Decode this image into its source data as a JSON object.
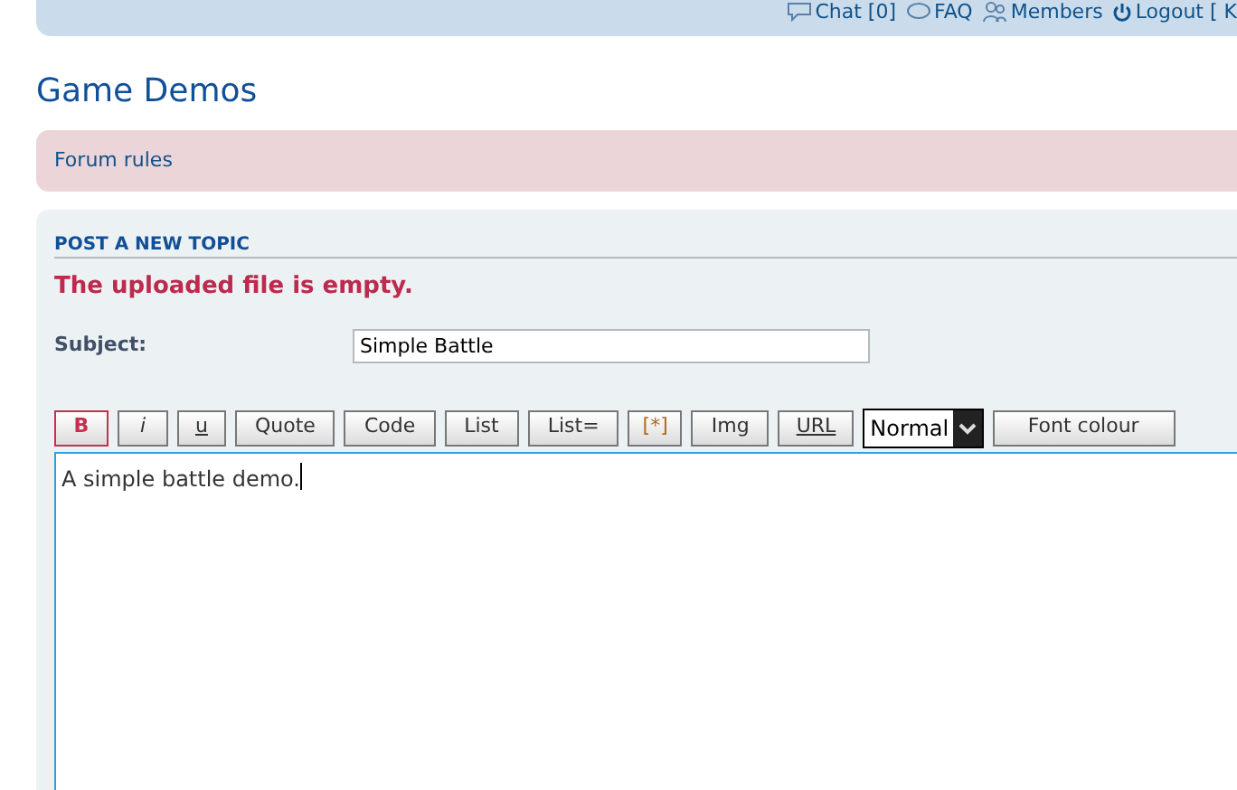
{
  "header_links": [
    {
      "kind": "chat",
      "label": "Chat [0]"
    },
    {
      "kind": "faq",
      "label": "FAQ"
    },
    {
      "kind": "members",
      "label": "Members"
    },
    {
      "kind": "logout",
      "label": "Logout [ K"
    }
  ],
  "page_title": "Game Demos",
  "forum_rules": "Forum rules",
  "panel": {
    "heading": "POST A NEW TOPIC",
    "error": "The uploaded file is empty.",
    "subject_label": "Subject:",
    "subject_value": "Simple Battle"
  },
  "toolbar": [
    {
      "label": "B",
      "kind": "bold"
    },
    {
      "label": "i",
      "kind": "italic"
    },
    {
      "label": "u",
      "kind": "underline"
    },
    {
      "label": "Quote",
      "kind": "plain"
    },
    {
      "label": "Code",
      "kind": "plain"
    },
    {
      "label": "List",
      "kind": "plain"
    },
    {
      "label": "List=",
      "kind": "plain"
    },
    {
      "label": "[*]",
      "kind": "listitem"
    },
    {
      "label": "Img",
      "kind": "plain"
    },
    {
      "label": "URL",
      "kind": "underline"
    },
    {
      "label": "Normal",
      "kind": "select"
    },
    {
      "label": "Font colour",
      "kind": "wide"
    }
  ],
  "message": "A simple battle demo."
}
